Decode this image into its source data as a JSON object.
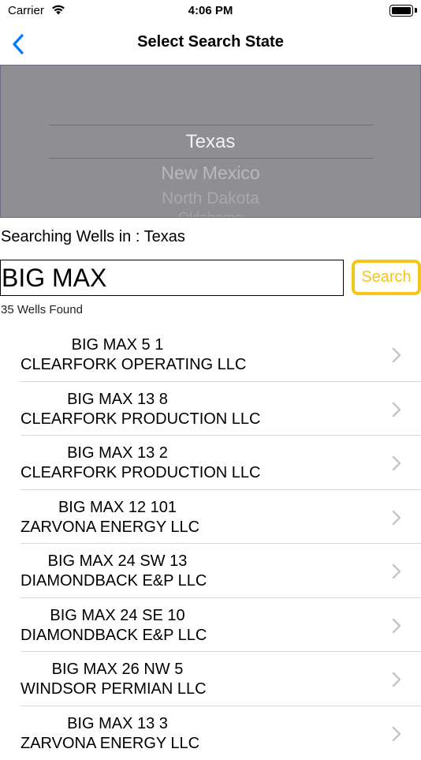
{
  "status_bar": {
    "carrier": "Carrier",
    "time": "4:06 PM"
  },
  "nav": {
    "title": "Select Search State",
    "back_icon": "chevron-left-icon"
  },
  "picker": {
    "options": [
      "Texas",
      "New Mexico",
      "North Dakota",
      "Oklahoma"
    ],
    "selected": "Texas"
  },
  "search": {
    "status_text": "Searching Wells in : Texas",
    "query": "BIG MAX",
    "button_label": "Search",
    "result_count": "35 Wells Found"
  },
  "colors": {
    "accent": "#007aff",
    "search_button": "#f5c518",
    "picker_bg": "#8e8e93"
  },
  "wells": [
    {
      "name": "BIG MAX 5 1",
      "operator": "CLEARFORK OPERATING LLC"
    },
    {
      "name": "BIG MAX 13 8",
      "operator": "CLEARFORK PRODUCTION LLC"
    },
    {
      "name": "BIG MAX 13 2",
      "operator": "CLEARFORK PRODUCTION LLC"
    },
    {
      "name": "BIG MAX 12 101",
      "operator": "ZARVONA ENERGY LLC"
    },
    {
      "name": "BIG MAX 24 SW 13",
      "operator": "DIAMONDBACK E&P LLC"
    },
    {
      "name": "BIG MAX 24 SE 10",
      "operator": "DIAMONDBACK E&P LLC"
    },
    {
      "name": "BIG MAX 26 NW 5",
      "operator": "WINDSOR PERMIAN LLC"
    },
    {
      "name": "BIG MAX 13 3",
      "operator": "ZARVONA ENERGY LLC"
    }
  ]
}
